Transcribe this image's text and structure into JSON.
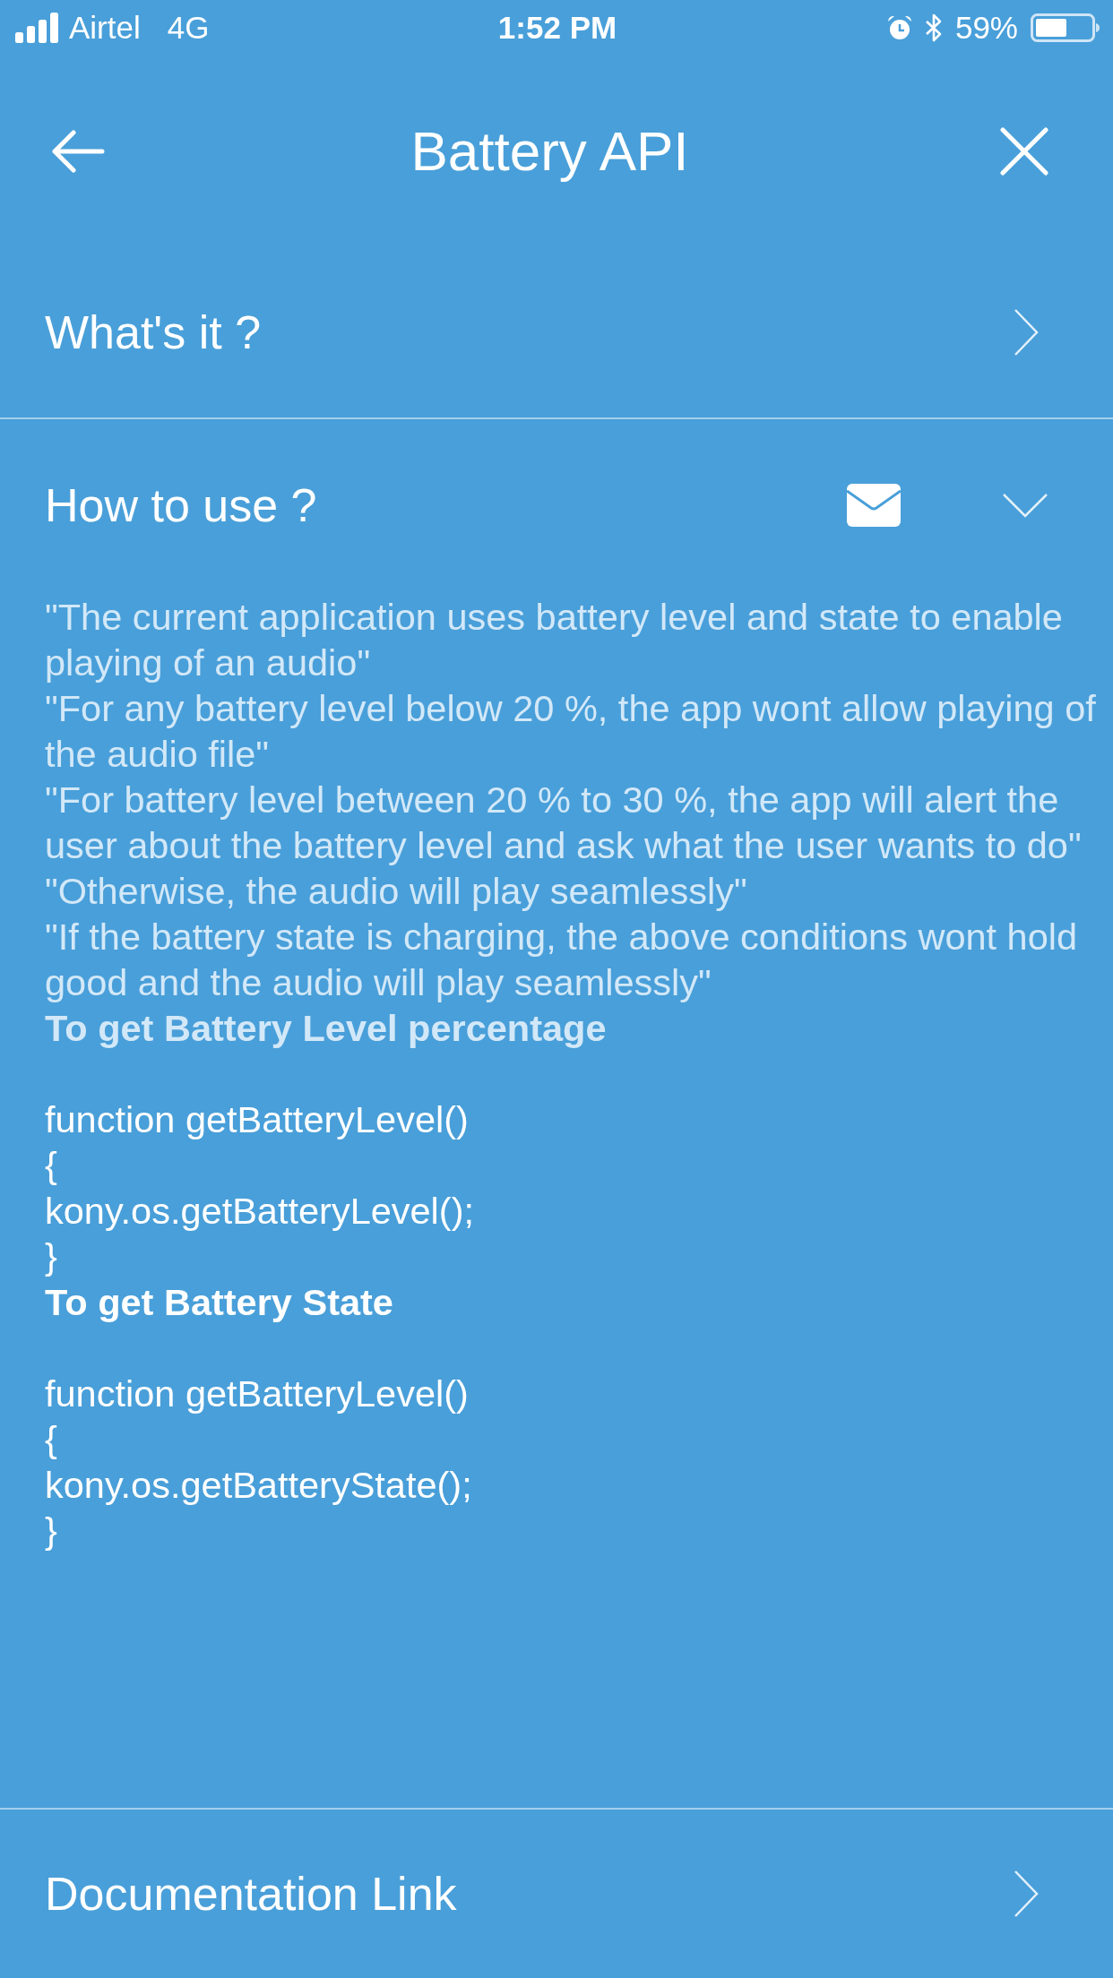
{
  "status_bar": {
    "carrier": "Airtel",
    "network": "4G",
    "time": "1:52 PM",
    "battery_percent": "59%"
  },
  "header": {
    "title": "Battery API"
  },
  "sections": [
    {
      "title": "What's it ?",
      "expanded": false
    },
    {
      "title": "How to use ?",
      "expanded": true,
      "content": [
        {
          "kind": "quote",
          "dimmed": true,
          "text": "\"The current application uses battery level and state to enable playing of an audio\""
        },
        {
          "kind": "quote",
          "dimmed": true,
          "text": "\"For any battery level below 20 %, the app wont allow playing of the audio file\""
        },
        {
          "kind": "quote",
          "dimmed": true,
          "text": "\"For battery level between 20 % to 30 %, the app will alert the user about the battery level and ask what the user wants to do\""
        },
        {
          "kind": "quote",
          "dimmed": true,
          "text": "\"Otherwise, the audio will play seamlessly\""
        },
        {
          "kind": "quote",
          "dimmed": true,
          "text": "\"If the battery state is charging, the above conditions wont hold good and the audio will play seamlessly\""
        },
        {
          "kind": "heading",
          "dimmed": true,
          "text": "To get Battery Level percentage"
        },
        {
          "kind": "code",
          "dimmed": false,
          "lines": [
            "function getBatteryLevel()",
            "{",
            "kony.os.getBatteryLevel();",
            "}"
          ]
        },
        {
          "kind": "heading",
          "dimmed": false,
          "text": "To get Battery State"
        },
        {
          "kind": "code",
          "dimmed": false,
          "lines": [
            "function getBatteryLevel()",
            "{",
            "kony.os.getBatteryState();",
            "}"
          ]
        }
      ]
    }
  ],
  "footer_link": {
    "label": "Documentation Link"
  }
}
